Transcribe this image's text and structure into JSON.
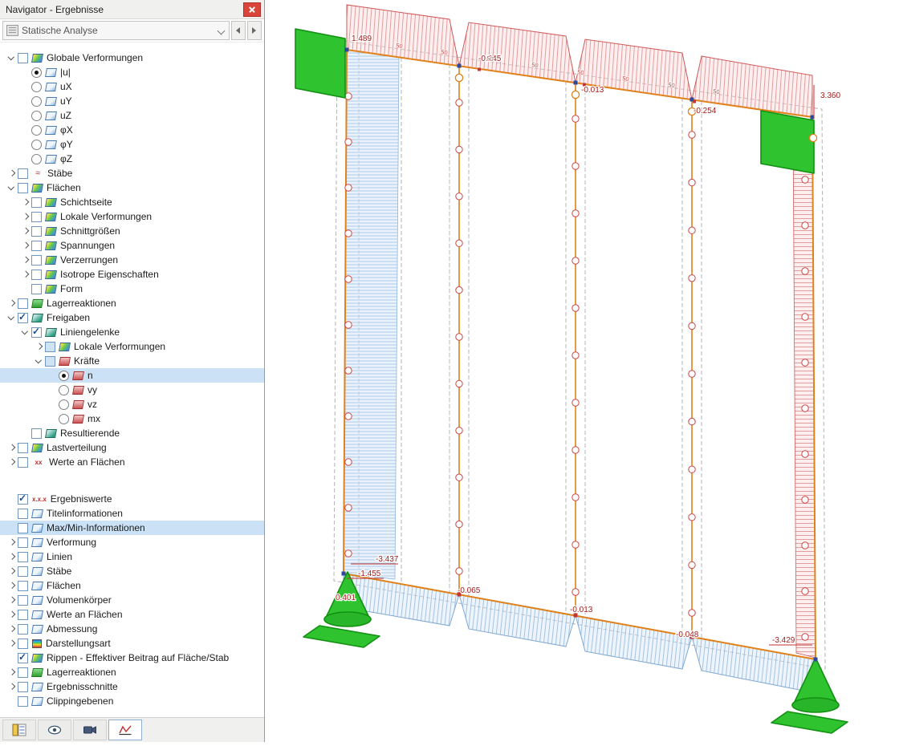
{
  "panel": {
    "title": "Navigator - Ergebnisse",
    "analysis_selector": {
      "value": "Statische Analyse"
    }
  },
  "navigator": {
    "tree": [
      {
        "label": "Globale Verformungen",
        "level": 0,
        "exp": "open",
        "ctrl": "cb",
        "icon": "surface-deformation-icon"
      },
      {
        "label": "|u|",
        "level": 1,
        "exp": null,
        "ctrl": "radio-on",
        "icon": "component-icon"
      },
      {
        "label": "uX",
        "level": 1,
        "exp": null,
        "ctrl": "radio",
        "icon": "component-icon"
      },
      {
        "label": "uY",
        "level": 1,
        "exp": null,
        "ctrl": "radio",
        "icon": "component-icon"
      },
      {
        "label": "uZ",
        "level": 1,
        "exp": null,
        "ctrl": "radio",
        "icon": "component-icon"
      },
      {
        "label": "φX",
        "level": 1,
        "exp": null,
        "ctrl": "radio",
        "icon": "component-icon"
      },
      {
        "label": "φY",
        "level": 1,
        "exp": null,
        "ctrl": "radio",
        "icon": "component-icon"
      },
      {
        "label": "φZ",
        "level": 1,
        "exp": null,
        "ctrl": "radio",
        "icon": "component-icon"
      },
      {
        "label": "Stäbe",
        "level": 0,
        "exp": "closed",
        "ctrl": "cb",
        "icon": "member-results-icon"
      },
      {
        "label": "Flächen",
        "level": 0,
        "exp": "open",
        "ctrl": "cb",
        "icon": "surfaces-icon"
      },
      {
        "label": "Schichtseite",
        "level": 1,
        "exp": "closed",
        "ctrl": "cb",
        "icon": "surfaces-icon"
      },
      {
        "label": "Lokale Verformungen",
        "level": 1,
        "exp": "closed",
        "ctrl": "cb",
        "icon": "surfaces-icon"
      },
      {
        "label": "Schnittgrößen",
        "level": 1,
        "exp": "closed",
        "ctrl": "cb",
        "icon": "surfaces-icon"
      },
      {
        "label": "Spannungen",
        "level": 1,
        "exp": "closed",
        "ctrl": "cb",
        "icon": "surfaces-icon"
      },
      {
        "label": "Verzerrungen",
        "level": 1,
        "exp": "closed",
        "ctrl": "cb",
        "icon": "surfaces-icon"
      },
      {
        "label": "Isotrope Eigenschaften",
        "level": 1,
        "exp": "closed",
        "ctrl": "cb",
        "icon": "surfaces-icon"
      },
      {
        "label": "Form",
        "level": 1,
        "exp": null,
        "ctrl": "cb",
        "icon": "surfaces-icon"
      },
      {
        "label": "Lagerreaktionen",
        "level": 0,
        "exp": "closed",
        "ctrl": "cb",
        "icon": "support-reaction-icon"
      },
      {
        "label": "Freigaben",
        "level": 0,
        "exp": "open",
        "ctrl": "cb-on",
        "icon": "release-icon"
      },
      {
        "label": "Liniengelenke",
        "level": 1,
        "exp": "open",
        "ctrl": "cb-on",
        "icon": "line-hinge-icon"
      },
      {
        "label": "Lokale Verformungen",
        "level": 2,
        "exp": "closed",
        "ctrl": "cb-part",
        "icon": "surfaces-icon"
      },
      {
        "label": "Kräfte",
        "level": 2,
        "exp": "open",
        "ctrl": "cb-part",
        "icon": "forces-icon"
      },
      {
        "label": "n",
        "level": 3,
        "exp": null,
        "ctrl": "radio-on",
        "icon": "hinge-force-icon",
        "hl": true
      },
      {
        "label": "vy",
        "level": 3,
        "exp": null,
        "ctrl": "radio",
        "icon": "hinge-force-icon"
      },
      {
        "label": "vz",
        "level": 3,
        "exp": null,
        "ctrl": "radio",
        "icon": "hinge-force-icon"
      },
      {
        "label": "mx",
        "level": 3,
        "exp": null,
        "ctrl": "radio",
        "icon": "hinge-force-icon"
      },
      {
        "label": "Resultierende",
        "level": 1,
        "exp": null,
        "ctrl": "cb",
        "icon": "resultant-icon"
      },
      {
        "label": "Lastverteilung",
        "level": 0,
        "exp": "closed",
        "ctrl": "cb",
        "icon": "load-distribution-icon"
      },
      {
        "label": "Werte an Flächen",
        "level": 0,
        "exp": "closed",
        "ctrl": "cb",
        "icon": "values-xx-icon",
        "iconText": "xx"
      },
      {
        "gap": true
      },
      {
        "label": "Ergebniswerte",
        "level": 0,
        "exp": null,
        "ctrl": "cb-on",
        "icon": "values-xxx-icon",
        "iconText": "x.x.x"
      },
      {
        "label": "Titelinformationen",
        "level": 0,
        "exp": null,
        "ctrl": "cb",
        "icon": "title-info-icon"
      },
      {
        "label": "Max/Min-Informationen",
        "level": 0,
        "exp": null,
        "ctrl": "cb",
        "icon": "maxmin-info-icon",
        "hl": true
      },
      {
        "label": "Verformung",
        "level": 0,
        "exp": "closed",
        "ctrl": "cb",
        "icon": "deformation-icon"
      },
      {
        "label": "Linien",
        "level": 0,
        "exp": "closed",
        "ctrl": "cb",
        "icon": "lines-icon"
      },
      {
        "label": "Stäbe",
        "level": 0,
        "exp": "closed",
        "ctrl": "cb",
        "icon": "members-icon"
      },
      {
        "label": "Flächen",
        "level": 0,
        "exp": "closed",
        "ctrl": "cb",
        "icon": "surfaces2-icon"
      },
      {
        "label": "Volumenkörper",
        "level": 0,
        "exp": "closed",
        "ctrl": "cb",
        "icon": "solids-icon"
      },
      {
        "label": "Werte an Flächen",
        "level": 0,
        "exp": "closed",
        "ctrl": "cb",
        "icon": "values-icon"
      },
      {
        "label": "Abmessung",
        "level": 0,
        "exp": "closed",
        "ctrl": "cb",
        "icon": "dimension-icon"
      },
      {
        "label": "Darstellungsart",
        "level": 0,
        "exp": "closed",
        "ctrl": "cb",
        "icon": "display-type-icon"
      },
      {
        "label": "Rippen - Effektiver Beitrag auf Fläche/Stab",
        "level": 0,
        "exp": null,
        "ctrl": "cb-on",
        "icon": "ribs-icon"
      },
      {
        "label": "Lagerreaktionen",
        "level": 0,
        "exp": "closed",
        "ctrl": "cb",
        "icon": "support-reaction-icon"
      },
      {
        "label": "Ergebnisschnitte",
        "level": 0,
        "exp": "closed",
        "ctrl": "cb",
        "icon": "result-sections-icon"
      },
      {
        "label": "Clippingebenen",
        "level": 0,
        "exp": null,
        "ctrl": "cb",
        "icon": "clipping-planes-icon"
      }
    ]
  },
  "tabs": [
    {
      "icon": "data-navigator-icon",
      "active": false
    },
    {
      "icon": "views-navigator-icon",
      "active": false
    },
    {
      "icon": "camera-icon",
      "active": false
    },
    {
      "icon": "results-navigator-icon",
      "active": true
    }
  ],
  "canvas": {
    "result_type": "n",
    "values": [
      "1.489",
      "-0.245",
      "-0.013",
      "-0.254",
      "3.360",
      "-3.437",
      "-1.455",
      "0.401",
      "-0.065",
      "-0.013",
      "-0.048",
      "-3.429"
    ],
    "tick_label": "50",
    "colors": {
      "selection": "#cbe2f6",
      "support_green": "#2fc32f",
      "line_orange": "#e0811a",
      "result_red": "#c03030",
      "result_blue": "#8fb6dc"
    }
  }
}
